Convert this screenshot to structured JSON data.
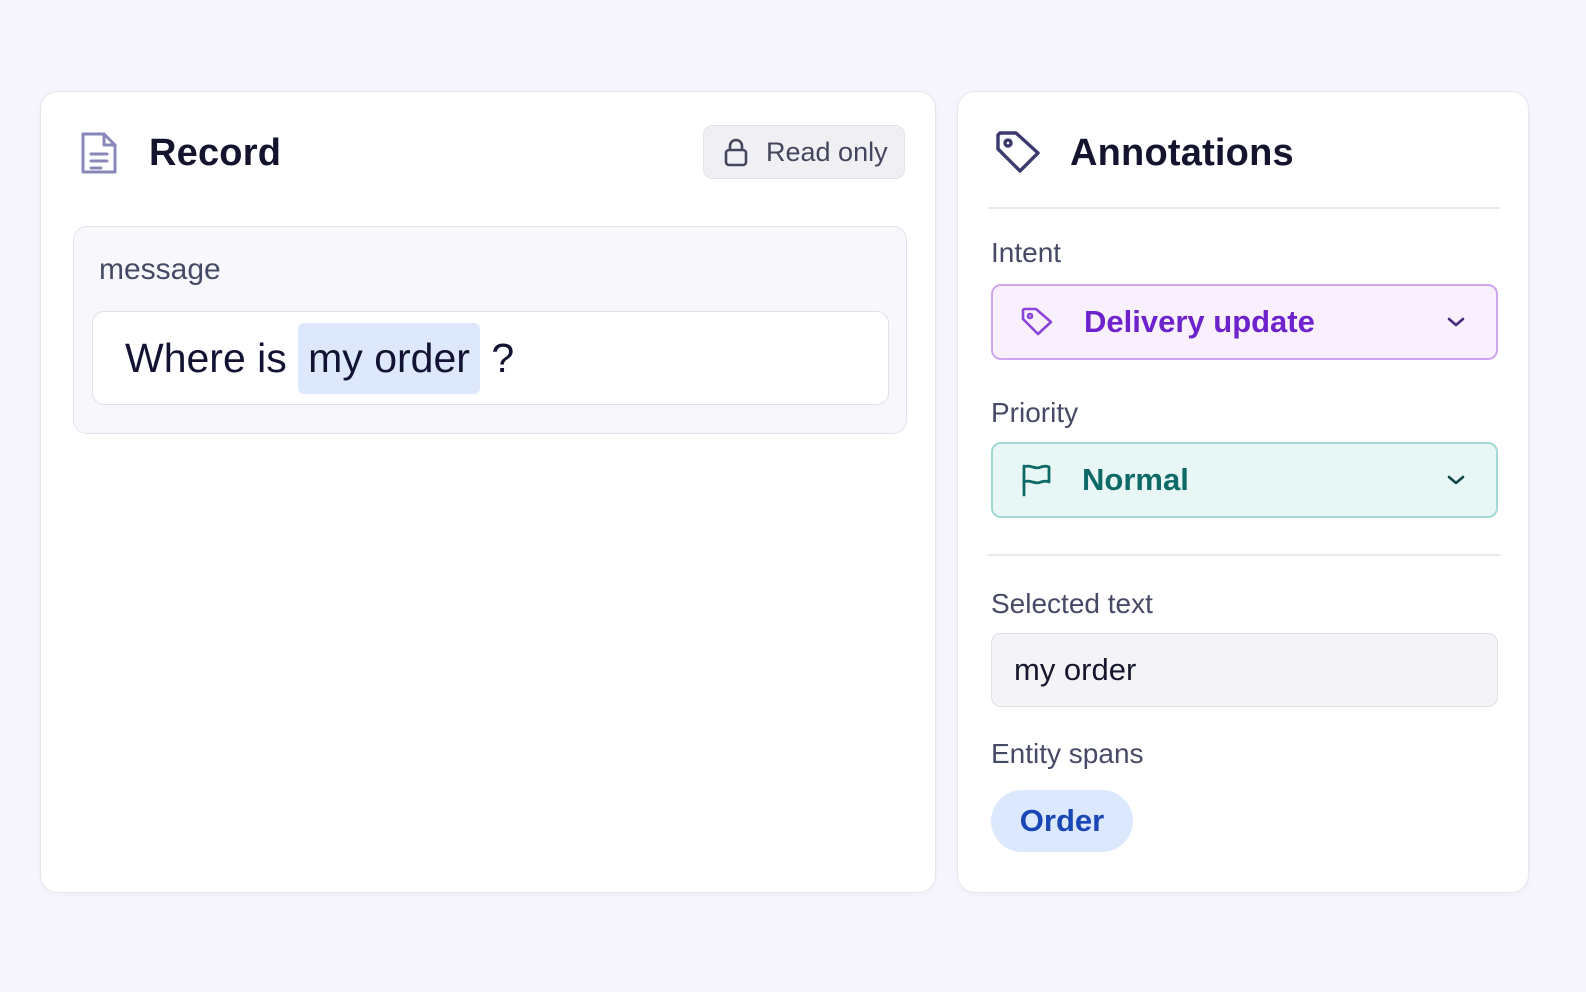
{
  "record": {
    "title": "Record",
    "badge": "Read only",
    "field_name": "message",
    "message": {
      "before": "Where is ",
      "highlight": "my order",
      "after": " ?"
    }
  },
  "annotations": {
    "title": "Annotations",
    "intent": {
      "label": "Intent",
      "value": "Delivery update"
    },
    "priority": {
      "label": "Priority",
      "value": "Normal"
    },
    "selected_text": {
      "label": "Selected text",
      "value": "my order"
    },
    "entity_spans": {
      "label": "Entity spans",
      "items": [
        "Order"
      ]
    }
  },
  "colors": {
    "background": "#f6f5fd",
    "intent_accent": "#6d22cc",
    "priority_accent": "#0e6a66",
    "highlight": "#dde8fd",
    "chip_text": "#1947b6"
  },
  "icons": {
    "record": "document-icon",
    "badge": "lock-icon",
    "annotations": "tag-icon",
    "intent": "tag-icon",
    "priority": "flag-icon",
    "dropdown": "chevron-down-icon"
  }
}
